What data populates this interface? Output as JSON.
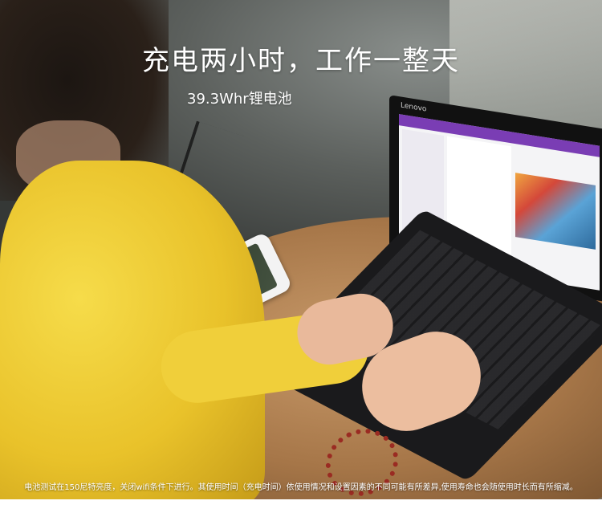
{
  "banner": {
    "headline": "充电两小时，工作一整天",
    "subheadline": "39.3Whr锂电池",
    "footnote": "电池测试在150尼特亮度，关闭wifi条件下进行。其使用时间（充电时间）依使用情况和设置因素的不同可能有所差异,使用寿命也会随使用时长而有所缩减。"
  },
  "device": {
    "brand": "Lenovo"
  },
  "colors": {
    "text": "#ffffff",
    "sweater": "#f0cf3a",
    "app_accent": "#7a3db4",
    "battery_charge": "#8fd94a"
  }
}
